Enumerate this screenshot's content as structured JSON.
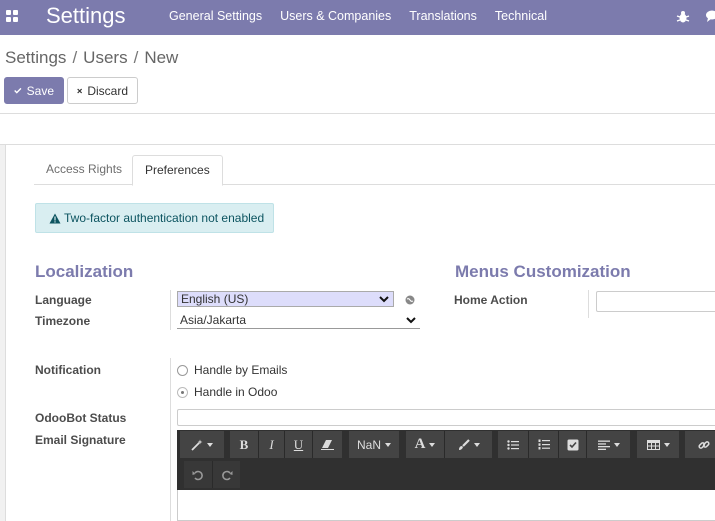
{
  "navbar": {
    "app_icon": "apps-grid-icon",
    "brand": "Settings",
    "menu": [
      "General Settings",
      "Users & Companies",
      "Translations",
      "Technical"
    ],
    "right_icons": [
      "bug-icon",
      "chat-icon"
    ]
  },
  "breadcrumb": [
    "Settings",
    "Users",
    "New"
  ],
  "buttons": {
    "save": "Save",
    "discard": "Discard"
  },
  "tabs": [
    {
      "label": "Access Rights",
      "active": false
    },
    {
      "label": "Preferences",
      "active": true
    }
  ],
  "alert": {
    "text": "Two-factor authentication not enabled",
    "icon": "warning-icon"
  },
  "localization": {
    "title": "Localization",
    "language_label": "Language",
    "language_value": "English (US)",
    "timezone_label": "Timezone",
    "timezone_value": "Asia/Jakarta"
  },
  "menus_customization": {
    "title": "Menus Customization",
    "home_action_label": "Home Action",
    "home_action_value": ""
  },
  "notification": {
    "label": "Notification",
    "options": [
      {
        "label": "Handle by Emails",
        "selected": false
      },
      {
        "label": "Handle in Odoo",
        "selected": true
      }
    ]
  },
  "odoobot": {
    "label": "OdooBot Status",
    "value": ""
  },
  "signature": {
    "label": "Email Signature",
    "font_size_label": "NaN",
    "toolbar_icons": [
      "magic-wand-icon",
      "bold-icon",
      "italic-icon",
      "underline-icon",
      "eraser-icon",
      "font-size-dropdown",
      "font-color-icon",
      "brush-icon",
      "unordered-list-icon",
      "ordered-list-icon",
      "checklist-icon",
      "align-icon",
      "table-icon",
      "link-icon",
      "undo-icon",
      "redo-icon"
    ]
  },
  "colors": {
    "brand": "#7c7bad",
    "alert_bg": "#d9eef1",
    "toolbar_bg": "#303030"
  }
}
